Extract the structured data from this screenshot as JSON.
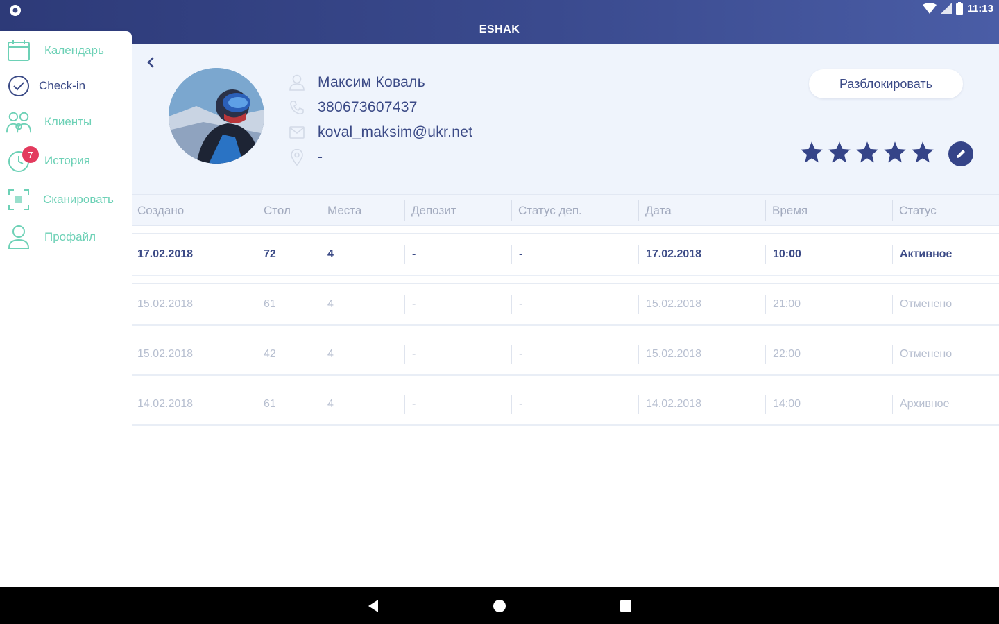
{
  "status_bar": {
    "time": "11:13"
  },
  "app": {
    "title": "ESHAK"
  },
  "sidebar": {
    "items": [
      {
        "label": "Календарь",
        "icon": "calendar-icon",
        "active": false
      },
      {
        "label": "Check-in",
        "icon": "check-circle-icon",
        "active": true
      },
      {
        "label": "Клиенты",
        "icon": "clients-icon",
        "active": false
      },
      {
        "label": "История",
        "icon": "history-clock-icon",
        "active": false,
        "badge": "7"
      },
      {
        "label": "Сканировать",
        "icon": "scan-icon",
        "active": false
      },
      {
        "label": "Профайл",
        "icon": "profile-icon",
        "active": false
      }
    ]
  },
  "client": {
    "name": "Максим Коваль",
    "phone": "380673607437",
    "email": "koval_maksim@ukr.net",
    "location": "-",
    "rating": 5,
    "unblock_label": "Разблокировать"
  },
  "table": {
    "headers": [
      "Создано",
      "Стол",
      "Места",
      "Депозит",
      "Статус деп.",
      "Дата",
      "Время",
      "Статус"
    ],
    "rows": [
      {
        "created": "17.02.2018",
        "table": "72",
        "seats": "4",
        "deposit": "-",
        "deposit_status": "-",
        "date": "17.02.2018",
        "time": "10:00",
        "status": "Активное"
      },
      {
        "created": "15.02.2018",
        "table": "61",
        "seats": "4",
        "deposit": "-",
        "deposit_status": "-",
        "date": "15.02.2018",
        "time": "21:00",
        "status": "Отменено"
      },
      {
        "created": "15.02.2018",
        "table": "42",
        "seats": "4",
        "deposit": "-",
        "deposit_status": "-",
        "date": "15.02.2018",
        "time": "22:00",
        "status": "Отменено"
      },
      {
        "created": "14.02.2018",
        "table": "61",
        "seats": "4",
        "deposit": "-",
        "deposit_status": "-",
        "date": "14.02.2018",
        "time": "14:00",
        "status": "Архивное"
      }
    ]
  },
  "colors": {
    "primary": "#3b4a86",
    "accent": "#6dd1b6",
    "badge": "#e33b5e",
    "header_bg": "#eff4fc"
  }
}
